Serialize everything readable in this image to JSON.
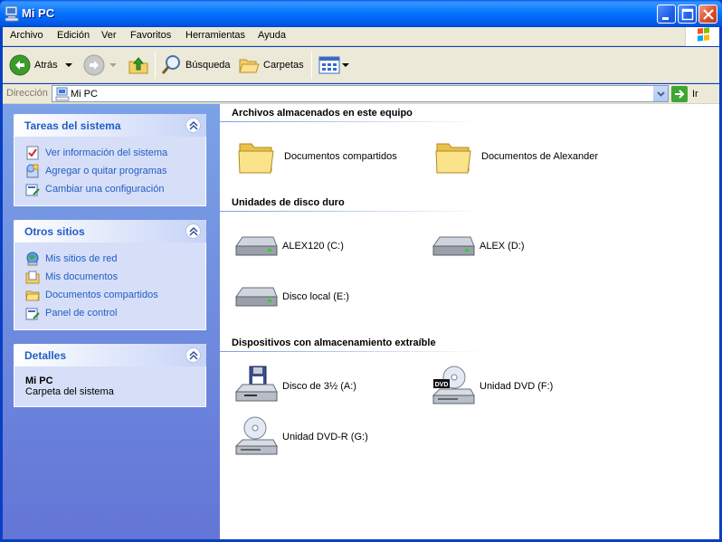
{
  "window": {
    "title": "Mi PC"
  },
  "menu": [
    "Archivo",
    "Edición",
    "Ver",
    "Favoritos",
    "Herramientas",
    "Ayuda"
  ],
  "toolbar": {
    "back_label": "Atrás",
    "search_label": "Búsqueda",
    "folders_label": "Carpetas"
  },
  "address": {
    "label": "Dirección",
    "value": "Mi PC",
    "go_label": "Ir"
  },
  "taskpane": {
    "system_tasks": {
      "title": "Tareas del sistema",
      "items": [
        "Ver información del sistema",
        "Agregar o quitar programas",
        "Cambiar una configuración"
      ]
    },
    "other_places": {
      "title": "Otros sitios",
      "items": [
        "Mis sitios de red",
        "Mis documentos",
        "Documentos compartidos",
        "Panel de control"
      ]
    },
    "details": {
      "title": "Detalles",
      "name": "Mi PC",
      "description": "Carpeta del sistema"
    }
  },
  "sections": {
    "stored_files": {
      "title": "Archivos almacenados en este equipo",
      "items": [
        "Documentos compartidos",
        "Documentos de Alexander"
      ]
    },
    "hard_drives": {
      "title": "Unidades de disco duro",
      "items": [
        "ALEX120 (C:)",
        "ALEX (D:)",
        "Disco local (E:)"
      ]
    },
    "removable": {
      "title": "Dispositivos con almacenamiento extraíble",
      "items": [
        "Disco de 3½ (A:)",
        "Unidad DVD (F:)",
        "Unidad DVD-R (G:)"
      ]
    }
  },
  "colors": {
    "title_bar": "#0a3fc4",
    "task_link": "#215dc6",
    "pane_bg": "#6f8ede"
  },
  "icons": {
    "dvd_badge": "DVD"
  }
}
